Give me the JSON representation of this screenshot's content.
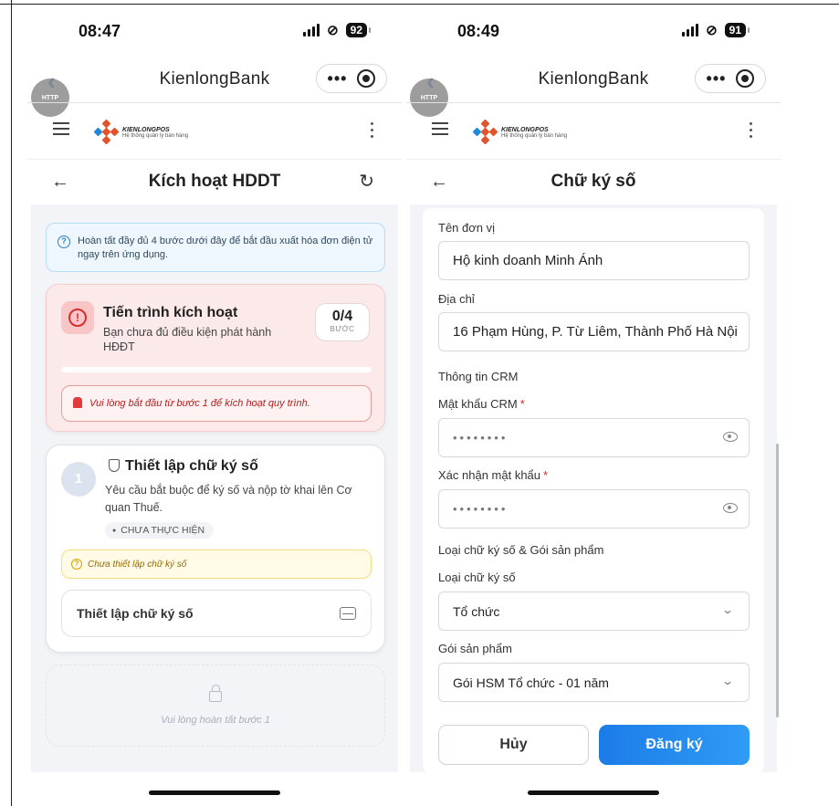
{
  "left": {
    "status": {
      "time": "08:47",
      "battery": "92"
    },
    "app": {
      "title": "KienlongBank",
      "http_badge": "HTTP",
      "more": "•••"
    },
    "logo": {
      "brand": "KIENLONGPOS",
      "sub": "Hệ thống quản lý bán hàng"
    },
    "page_title": "Kích hoạt HDDT",
    "info": "Hoàn tất đầy đủ 4 bước dưới đây để bắt đầu xuất hóa đơn điện tử ngay trên ứng dụng.",
    "progress": {
      "title": "Tiến trình kích hoạt",
      "subtitle": "Bạn chưa đủ điều kiện phát hành HĐĐT",
      "count": "0/4",
      "unit": "BƯỚC",
      "fraction": 0,
      "alert": "Vui lòng bắt đầu từ bước 1 để kích hoạt quy trình."
    },
    "step1": {
      "number": "1",
      "title": "Thiết lập chữ ký số",
      "description": "Yêu cầu bắt buộc để ký số và nộp tờ khai lên Cơ quan Thuế.",
      "status": "CHƯA THỰC HIỆN",
      "warning": "Chưa thiết lập chữ ký số",
      "action": "Thiết lập chữ ký số"
    },
    "step2_locked": "Vui lòng hoàn tất bước 1"
  },
  "right": {
    "status": {
      "time": "08:49",
      "battery": "91"
    },
    "app": {
      "title": "KienlongBank",
      "http_badge": "HTTP",
      "more": "•••"
    },
    "logo": {
      "brand": "KIENLONGPOS",
      "sub": "Hệ thống quản lý bán hàng"
    },
    "page_title": "Chữ ký số",
    "form": {
      "unit_name_label": "Tên đơn vị",
      "unit_name_value": "Hộ kinh doanh Minh Ánh",
      "address_label": "Địa chỉ",
      "address_value": "16 Phạm Hùng, P. Từ Liêm, Thành Phố Hà Nội",
      "crm_section": "Thông tin CRM",
      "crm_password_label": "Mật khẩu CRM",
      "crm_password_value": "••••••••",
      "confirm_password_label": "Xác nhận mật khẩu",
      "confirm_password_value": "••••••••",
      "required_mark": "*",
      "signature_section": "Loại chữ ký số & Gói sản phẩm",
      "signature_type_label": "Loại chữ ký số",
      "signature_type_value": "Tổ chức",
      "package_label": "Gói sản phẩm",
      "package_value": "Gói HSM Tổ chức - 01 năm",
      "cancel_button": "Hủy",
      "submit_button": "Đăng ký"
    }
  },
  "colors": {
    "accent": "#1c7ce8",
    "danger": "#d62d2d",
    "warning": "#d6a300"
  },
  "icons": [
    "back-chevron-icon",
    "more-icon",
    "target-icon",
    "hamburger-icon",
    "kebab-icon",
    "back-arrow-icon",
    "refresh-icon",
    "info-icon",
    "alert-circle-icon",
    "siren-icon",
    "shield-icon",
    "drive-icon",
    "lock-icon",
    "eye-icon",
    "chevron-down-icon"
  ]
}
